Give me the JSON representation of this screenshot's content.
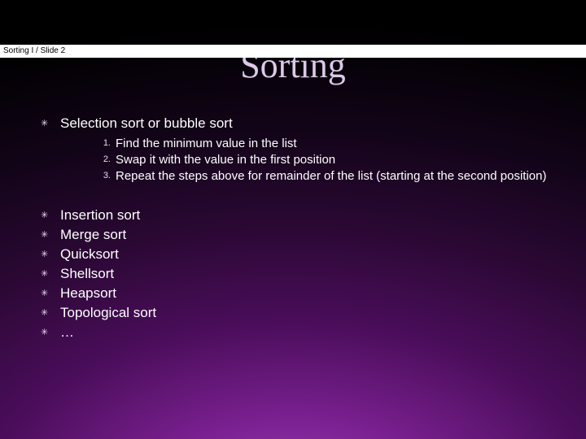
{
  "header": {
    "text": "Sorting I  / Slide 2"
  },
  "title": "Sorting",
  "bullets_top": [
    {
      "label": "Selection sort or bubble sort"
    }
  ],
  "steps": [
    {
      "n": "1.",
      "text": "Find the minimum value in the list"
    },
    {
      "n": "2.",
      "text": "Swap it with the value in the first position"
    },
    {
      "n": "3.",
      "text": "Repeat the steps above for remainder of the list (starting at the second position)"
    }
  ],
  "bullets_rest": [
    {
      "label": "Insertion sort"
    },
    {
      "label": "Merge sort"
    },
    {
      "label": "Quicksort"
    },
    {
      "label": "Shellsort"
    },
    {
      "label": "Heapsort"
    },
    {
      "label": "Topological sort"
    },
    {
      "label": "…"
    }
  ],
  "glyph": "✳"
}
